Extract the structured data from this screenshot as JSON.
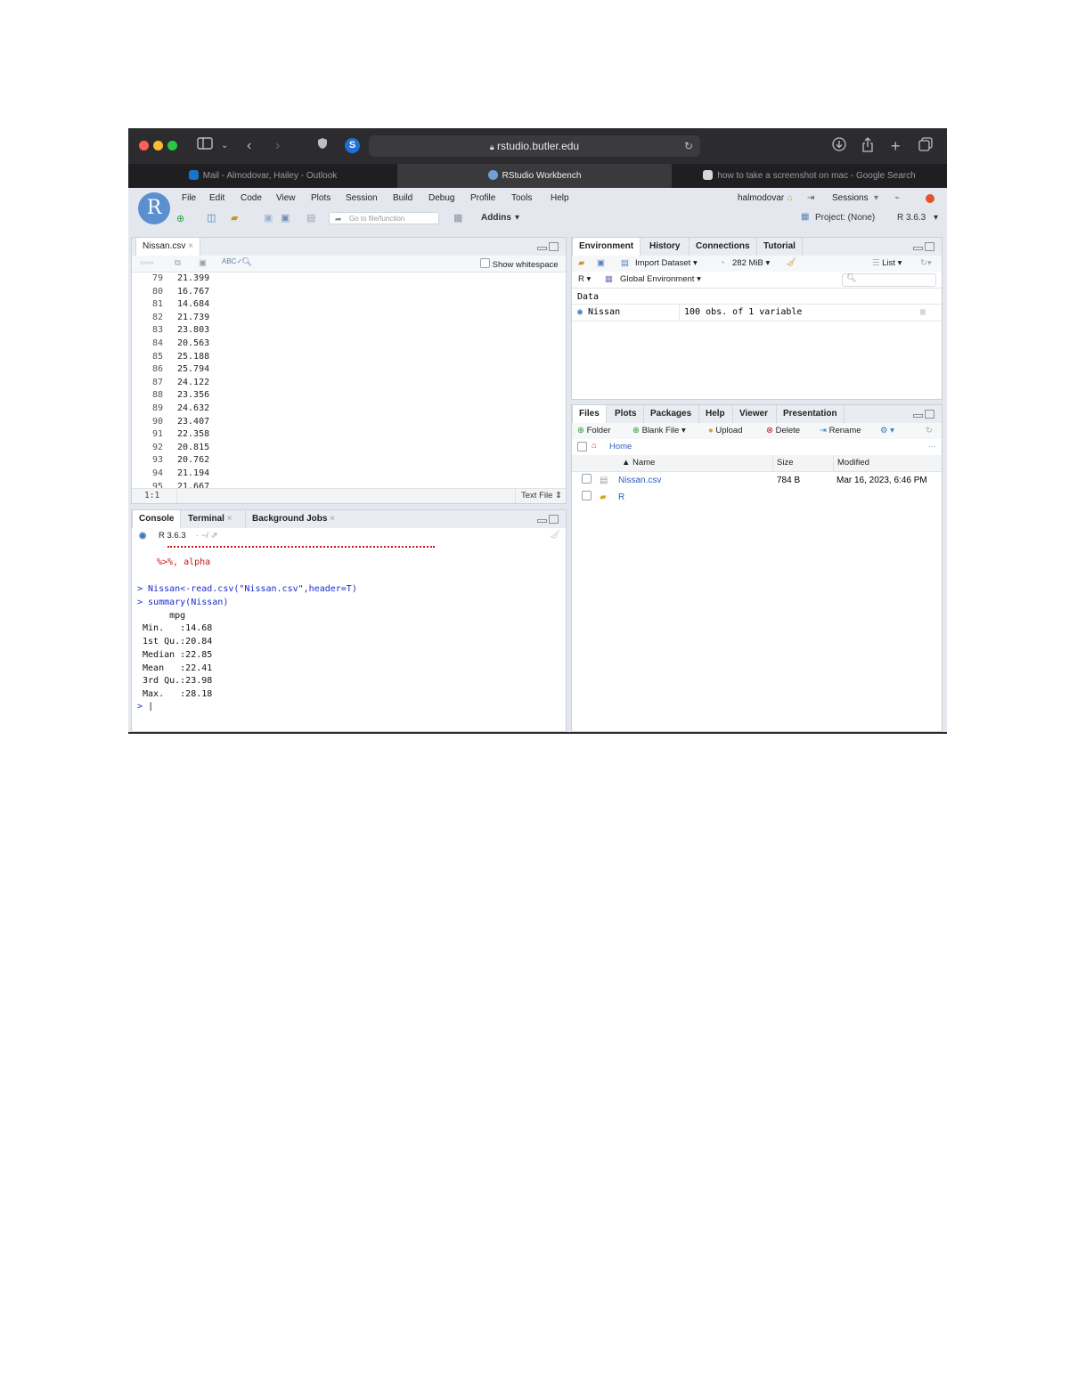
{
  "browser": {
    "url": "rstudio.butler.edu",
    "tabs": [
      {
        "label": "Mail - Almodovar, Hailey - Outlook"
      },
      {
        "label": "RStudio Workbench"
      },
      {
        "label": "how to take a screenshot on mac - Google Search"
      }
    ]
  },
  "rstudio": {
    "menu": [
      "File",
      "Edit",
      "Code",
      "View",
      "Plots",
      "Session",
      "Build",
      "Debug",
      "Profile",
      "Tools",
      "Help"
    ],
    "user": "halmodovar",
    "sessions_label": "Sessions",
    "goto_placeholder": "Go to file/function",
    "addins_label": "Addins",
    "project_label": "Project: (None)",
    "r_version": "R 3.6.3",
    "editor": {
      "tab": "Nissan.csv",
      "show_whitespace": "Show whitespace",
      "lines": [
        {
          "n": "79",
          "v": "21.399"
        },
        {
          "n": "80",
          "v": "16.767"
        },
        {
          "n": "81",
          "v": "14.684"
        },
        {
          "n": "82",
          "v": "21.739"
        },
        {
          "n": "83",
          "v": "23.803"
        },
        {
          "n": "84",
          "v": "20.563"
        },
        {
          "n": "85",
          "v": "25.188"
        },
        {
          "n": "86",
          "v": "25.794"
        },
        {
          "n": "87",
          "v": "24.122"
        },
        {
          "n": "88",
          "v": "23.356"
        },
        {
          "n": "89",
          "v": "24.632"
        },
        {
          "n": "90",
          "v": "23.407"
        },
        {
          "n": "91",
          "v": "22.358"
        },
        {
          "n": "92",
          "v": "20.815"
        },
        {
          "n": "93",
          "v": "20.762"
        },
        {
          "n": "94",
          "v": "21.194"
        },
        {
          "n": "95",
          "v": "21.667"
        }
      ],
      "cursor_pos": "1:1",
      "file_type": "Text File"
    },
    "console": {
      "tabs": [
        "Console",
        "Terminal",
        "Background Jobs"
      ],
      "header": "R 3.6.3",
      "path": "~/",
      "error_fragment": "%>%, alpha",
      "cmd1": "> Nissan<-read.csv(\"Nissan.csv\",header=T)",
      "cmd2": "> summary(Nissan)",
      "summary_header": "      mpg",
      "summary_rows": [
        " Min.   :14.68",
        " 1st Qu.:20.84",
        " Median :22.85",
        " Mean   :22.41",
        " 3rd Qu.:23.98",
        " Max.   :28.18"
      ],
      "prompt": ">"
    },
    "environment": {
      "tabs": [
        "Environment",
        "History",
        "Connections",
        "Tutorial"
      ],
      "import_label": "Import Dataset",
      "memory": "282 MiB",
      "list_label": "List",
      "lang": "R",
      "scope": "Global Environment",
      "section": "Data",
      "objects": [
        {
          "name": "Nissan",
          "desc": "100 obs. of 1 variable"
        }
      ]
    },
    "files": {
      "tabs": [
        "Files",
        "Plots",
        "Packages",
        "Help",
        "Viewer",
        "Presentation"
      ],
      "toolbar": [
        "Folder",
        "Blank File",
        "Upload",
        "Delete",
        "Rename"
      ],
      "breadcrumb": "Home",
      "columns": [
        "Name",
        "Size",
        "Modified"
      ],
      "rows": [
        {
          "name": "Nissan.csv",
          "size": "784 B",
          "modified": "Mar 16, 2023, 6:46 PM"
        },
        {
          "name": "R",
          "size": "",
          "modified": ""
        }
      ]
    }
  }
}
